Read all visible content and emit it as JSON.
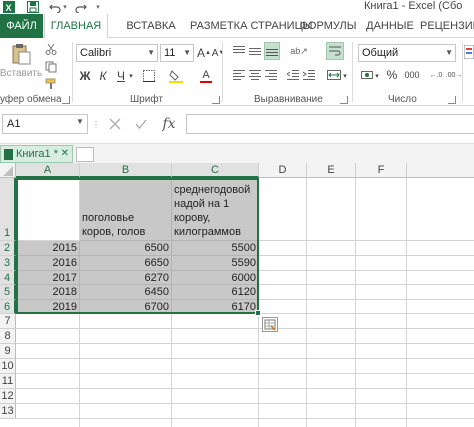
{
  "window": {
    "title": "Книга1 - Excel (Сбо"
  },
  "quick_access": {
    "icons": [
      "excel-logo",
      "save",
      "undo",
      "redo"
    ]
  },
  "ribbon_tabs": [
    "ФАЙЛ",
    "ГЛАВНАЯ",
    "ВСТАВКА",
    "РАЗМЕТКА СТРАНИЦЫ",
    "ФОРМУЛЫ",
    "ДАННЫЕ",
    "РЕЦЕНЗИРО"
  ],
  "ribbon": {
    "clipboard": {
      "paste_label": "Вставить",
      "group_label": "уфер обмена"
    },
    "font": {
      "name": "Calibri",
      "size": "11",
      "group_label": "Шрифт",
      "bold": "Ж",
      "italic": "К",
      "underline": "Ч",
      "grow": "A",
      "shrink": "A",
      "font_color_letter": "A"
    },
    "alignment": {
      "group_label": "Выравнивание"
    },
    "number": {
      "format": "Общий",
      "group_label": "Число",
      "percent": "%",
      "thousands": "000"
    }
  },
  "formula_bar": {
    "name_box": "A1",
    "fx": "fx",
    "value": ""
  },
  "workbook_tab": {
    "label": "Книга1 *"
  },
  "grid": {
    "columns": [
      "A",
      "B",
      "C",
      "D",
      "E",
      "F"
    ],
    "rows": [
      "1",
      "2",
      "3",
      "4",
      "5",
      "6",
      "7",
      "8",
      "9",
      "10",
      "11",
      "12",
      "13"
    ],
    "header_cells": {
      "A1": "",
      "B1": "поголовье коров, голов",
      "C1": "среднегодовой надой на 1 корову, килограммов"
    },
    "data": [
      {
        "A": "2015",
        "B": "6500",
        "C": "5500"
      },
      {
        "A": "2016",
        "B": "6650",
        "C": "5590"
      },
      {
        "A": "2017",
        "B": "6270",
        "C": "6000"
      },
      {
        "A": "2018",
        "B": "6450",
        "C": "6120"
      },
      {
        "A": "2019",
        "B": "6700",
        "C": "6170"
      }
    ]
  },
  "colors": {
    "excel_green": "#217346",
    "selection_fill": "#c8c8c8"
  }
}
